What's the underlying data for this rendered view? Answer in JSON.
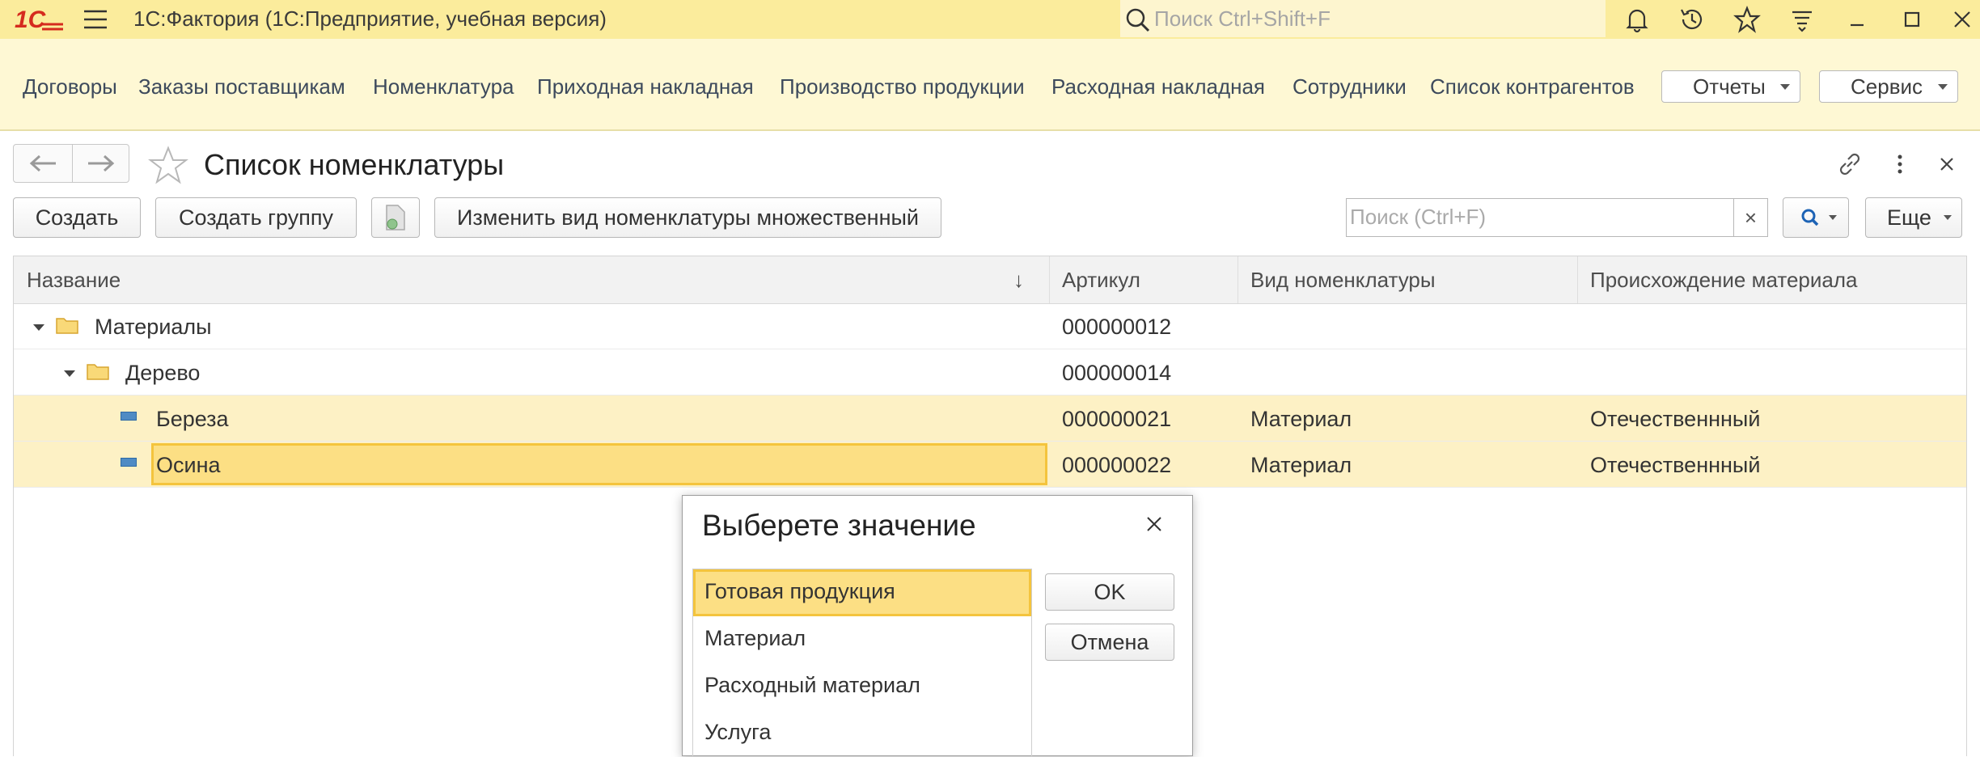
{
  "window": {
    "title": "1С:Фактория  (1С:Предприятие, учебная версия)",
    "search_placeholder": "Поиск Ctrl+Shift+F"
  },
  "sections": {
    "links": [
      "Договоры",
      "Заказы поставщикам",
      "Номенклатура",
      "Приходная накладная",
      "Производство продукции",
      "Расходная накладная",
      "Сотрудники",
      "Список контрагентов"
    ],
    "reports_label": "Отчеты",
    "service_label": "Сервис"
  },
  "form": {
    "title": "Список номенклатуры",
    "buttons": {
      "create": "Создать",
      "create_group": "Создать группу",
      "change_kind": "Изменить вид номенклатуры множественный",
      "more": "Еще"
    },
    "search_placeholder": "Поиск (Ctrl+F)",
    "clear_symbol": "×"
  },
  "table": {
    "columns": [
      "Название",
      "Артикул",
      "Вид номенклатуры",
      "Происхождение материала"
    ],
    "sort_indicator": "↓",
    "rows": [
      {
        "name": "Материалы",
        "article": "000000012",
        "kind": "",
        "origin": "",
        "type": "group",
        "level": 0
      },
      {
        "name": "Дерево",
        "article": "000000014",
        "kind": "",
        "origin": "",
        "type": "group",
        "level": 1
      },
      {
        "name": "Береза",
        "article": "000000021",
        "kind": "Материал",
        "origin": "Отечественнный",
        "type": "item",
        "level": 2
      },
      {
        "name": "Осина",
        "article": "000000022",
        "kind": "Материал",
        "origin": "Отечественнный",
        "type": "item",
        "level": 2
      }
    ]
  },
  "dialog": {
    "title": "Выберете значение",
    "options": [
      "Готовая продукция",
      "Материал",
      "Расходный материал",
      "Услуга"
    ],
    "selected_option": "Готовая продукция",
    "ok_label": "OK",
    "cancel_label": "Отмена"
  },
  "colors": {
    "titlebar": "#fbec9c",
    "section_panel": "#fef8d4",
    "selection": "#fcdf84",
    "selection_border": "#f4c43d",
    "logo_red": "#d52b1e"
  }
}
